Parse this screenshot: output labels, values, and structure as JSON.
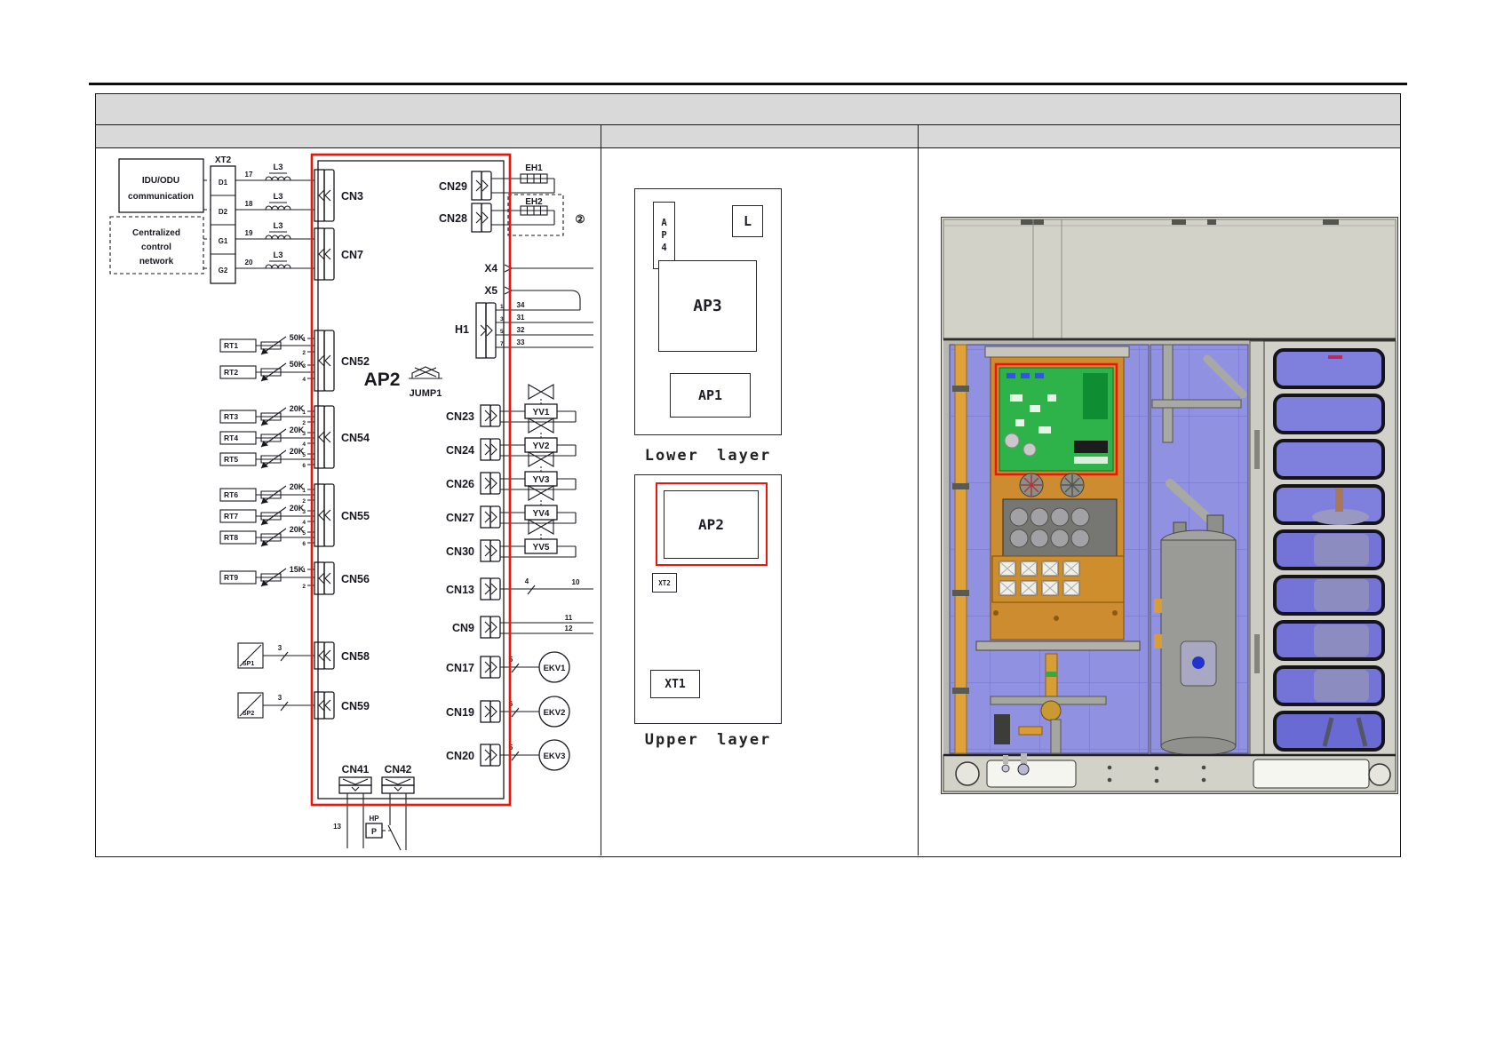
{
  "wiring": {
    "board_label": "AP2",
    "jumper": {
      "label": "JUMP1"
    },
    "terminal_block": {
      "label": "XT2",
      "terminals": [
        "D1",
        "D2",
        "G1",
        "G2"
      ]
    },
    "idu_box": {
      "lines": [
        "IDU/ODU",
        "communication"
      ]
    },
    "central_box": {
      "lines": [
        "Centralized",
        "control",
        "network"
      ]
    },
    "comm_lines": [
      {
        "num": "17",
        "inductor": "L3"
      },
      {
        "num": "18",
        "inductor": "L3"
      },
      {
        "num": "19",
        "inductor": "L3"
      },
      {
        "num": "20",
        "inductor": "L3"
      }
    ],
    "comm_connectors": [
      "CN3",
      "CN7"
    ],
    "sensor_groups": [
      {
        "connector": "CN52",
        "pins": [
          "1",
          "2",
          "3",
          "4"
        ],
        "sensors": [
          {
            "name": "RT1",
            "value": "50K"
          },
          {
            "name": "RT2",
            "value": "50K"
          }
        ]
      },
      {
        "connector": "CN54",
        "pins": [
          "1",
          "2",
          "3",
          "4",
          "5",
          "6"
        ],
        "sensors": [
          {
            "name": "RT3",
            "value": "20K"
          },
          {
            "name": "RT4",
            "value": "20K"
          },
          {
            "name": "RT5",
            "value": "20K"
          }
        ]
      },
      {
        "connector": "CN55",
        "pins": [
          "1",
          "2",
          "3",
          "4",
          "5",
          "6"
        ],
        "sensors": [
          {
            "name": "RT6",
            "value": "20K"
          },
          {
            "name": "RT7",
            "value": "20K"
          },
          {
            "name": "RT8",
            "value": "20K"
          }
        ]
      },
      {
        "connector": "CN56",
        "pins": [
          "1",
          "2"
        ],
        "sensors": [
          {
            "name": "RT9",
            "value": "15K"
          }
        ]
      }
    ],
    "pressure_sensors": [
      {
        "name": "SP1",
        "wire_count": "3",
        "connector": "CN58"
      },
      {
        "name": "SP2",
        "wire_count": "3",
        "connector": "CN59"
      }
    ],
    "power_connectors": {
      "left": "CN41",
      "right": "CN42",
      "wire_num": "13",
      "hp_switch": {
        "label": "HP",
        "symbol": "P"
      }
    },
    "heater_rows": [
      {
        "connector": "CN29",
        "load": "EH1"
      },
      {
        "connector": "CN28",
        "load": "EH2",
        "note": "②"
      }
    ],
    "aux_points": [
      "X4",
      "X5"
    ],
    "h1": {
      "label": "H1",
      "pins": [
        "1",
        "3",
        "5",
        "7"
      ],
      "wire_nums": [
        "34",
        "31",
        "32",
        "33"
      ]
    },
    "valve_rows": [
      {
        "connector": "CN23",
        "load": "YV1"
      },
      {
        "connector": "CN24",
        "load": "YV2"
      },
      {
        "connector": "CN26",
        "load": "YV3"
      },
      {
        "connector": "CN27",
        "load": "YV4"
      },
      {
        "connector": "CN30",
        "load": "YV5"
      }
    ],
    "signal_rows": [
      {
        "connector": "CN13",
        "slash_num": "4",
        "wire_num": "10"
      },
      {
        "connector": "CN9",
        "wire_nums": [
          "11",
          "12"
        ]
      }
    ],
    "ekv_rows": [
      {
        "connector": "CN17",
        "slash_num": "5",
        "load": "EKV1"
      },
      {
        "connector": "CN19",
        "slash_num": "6",
        "load": "EKV2"
      },
      {
        "connector": "CN20",
        "slash_num": "5",
        "load": "EKV3"
      }
    ]
  },
  "layout": {
    "lower": {
      "caption": "Lower layer",
      "ap4": [
        "A",
        "P",
        "4"
      ],
      "l_label": "L",
      "ap3": "AP3",
      "ap1": "AP1"
    },
    "upper": {
      "caption": "Upper layer",
      "ap2": "AP2",
      "xt2": "XT2",
      "xt1": "XT1"
    }
  },
  "colors": {
    "highlight_red": "#ee1409",
    "header_gray": "#d9d9d9",
    "pcb_green": "#2eb34a",
    "plate_orange": "#cd8c2f",
    "coil_blue": "#9191e2",
    "cabinet_gray": "#d2d2c9"
  }
}
